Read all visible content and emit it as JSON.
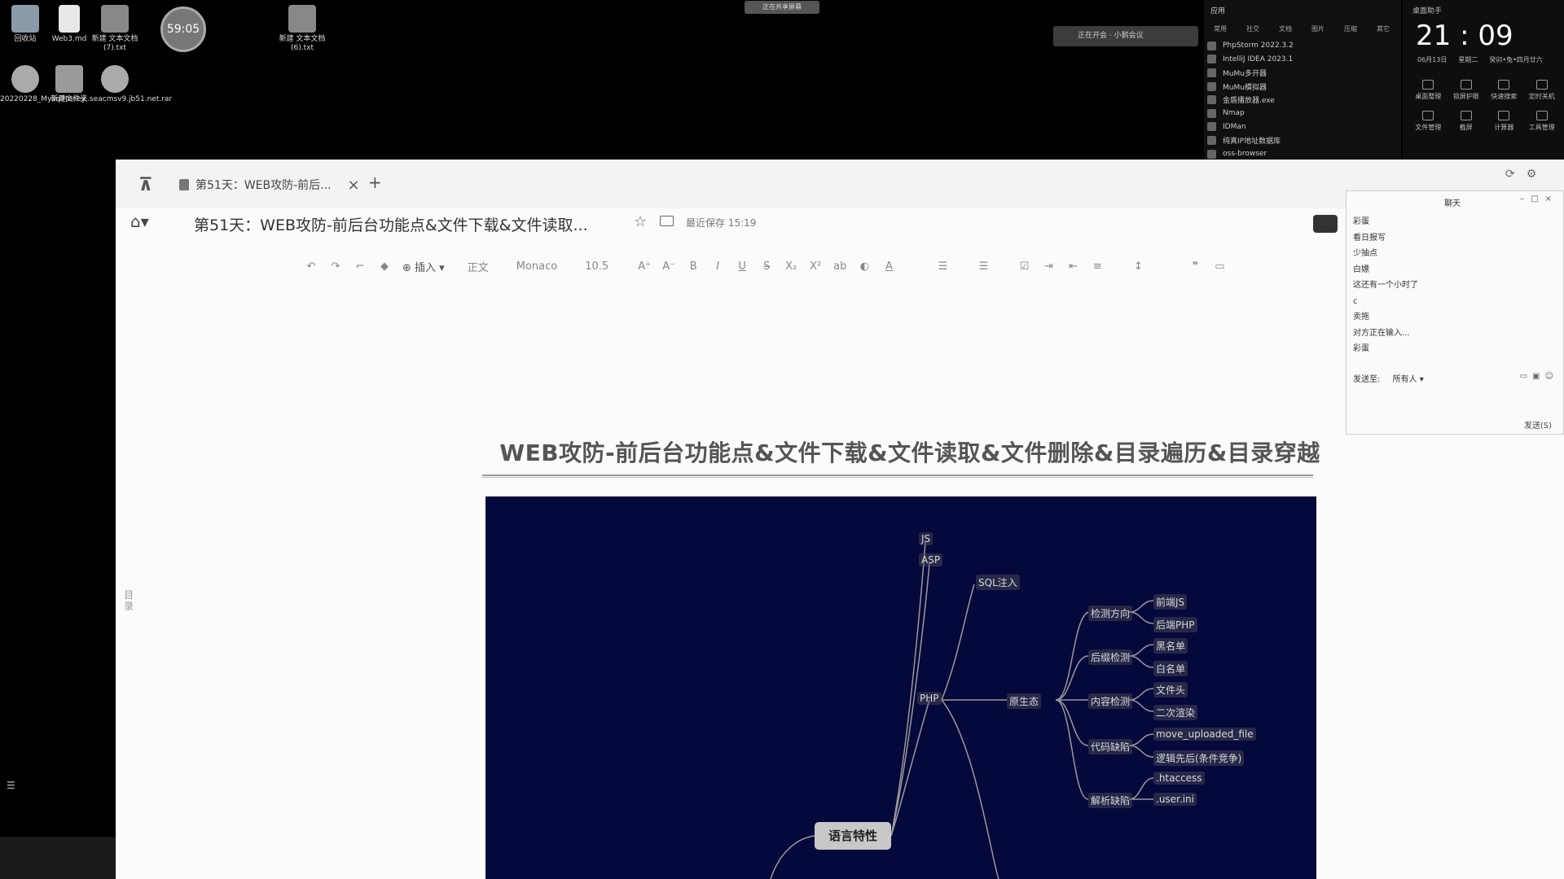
{
  "desktop": {
    "icons": [
      {
        "label": "回收站"
      },
      {
        "label": "Web3.md"
      },
      {
        "label": "新建 文本文档 (7).txt"
      },
      {
        "label": "新建 文本文档 (6).txt"
      },
      {
        "label": "20220228_MysqlHoney..."
      },
      {
        "label": "新建文件夹"
      },
      {
        "label": "seacmsv9.jb51.net.rar"
      }
    ],
    "timer": "59:05",
    "share_bar": "正在共享屏幕",
    "pill_text": "正在开会 · 小鹅会议"
  },
  "app_panel": {
    "header": "应用",
    "tabs": [
      "常用",
      "社交",
      "文档",
      "图片",
      "压缩",
      "其它"
    ],
    "apps": [
      "PhpStorm 2022.3.2",
      "IntelliJ IDEA 2023.1",
      "MuMu多开器",
      "MuMu模拟器",
      "金盾播放器.exe",
      "Nmap",
      "IDMan",
      "纯真IP地址数据库",
      "oss-browser"
    ]
  },
  "clock_panel": {
    "label": "桌面助手",
    "time": "21 : 09",
    "date": "06月13日",
    "weekday": "星期二",
    "lunar": "癸卯•兔•四月廿六",
    "quick_actions": [
      "桌面整理",
      "锁屏护眼",
      "快速搜索",
      "定时关机",
      "文件管理",
      "截屏",
      "计算器",
      "工具管理"
    ]
  },
  "editor": {
    "tab_title": "第51天：WEB攻防-前后...",
    "doc_title": "第51天：WEB攻防-前后台功能点&文件下载&文件读取...",
    "saved_status": "最近保存 15:19",
    "toolbar": {
      "insert": "插入",
      "style": "正文",
      "font": "Monaco",
      "size": "10.5"
    },
    "catalog_label": "目录",
    "heading": "WEB攻防-前后台功能点&文件下载&文件读取&文件删除&目录遍历&目录穿越"
  },
  "mindmap": {
    "root": "语言特性",
    "nodes": {
      "js": "JS",
      "asp": "ASP",
      "php": "PHP",
      "sql": "SQL注入",
      "native": "原生态",
      "check_dir": "检测方向",
      "front_js": "前端JS",
      "back_php": "后端PHP",
      "suffix": "后缀检测",
      "blacklist": "黑名单",
      "whitelist": "白名单",
      "content": "内容检测",
      "file_header": "文件头",
      "second_render": "二次渲染",
      "code_flaw": "代码缺陷",
      "move_uploaded": "move_uploaded_file",
      "logic_order": "逻辑先后(条件竞争)",
      "parse_flaw": "解析缺陷",
      "htaccess": ".htaccess",
      "userini": ".user.ini"
    }
  },
  "chat": {
    "title": "聊天",
    "messages": [
      "彩蛋",
      "看日报写",
      "少抽点",
      "白嫖",
      "这还有一个小时了",
      "c",
      "卖拖",
      "对方正在输入...",
      "彩蛋"
    ],
    "send_to_label": "发送至:",
    "send_to_value": "所有人",
    "send_button": "发送(S)"
  }
}
